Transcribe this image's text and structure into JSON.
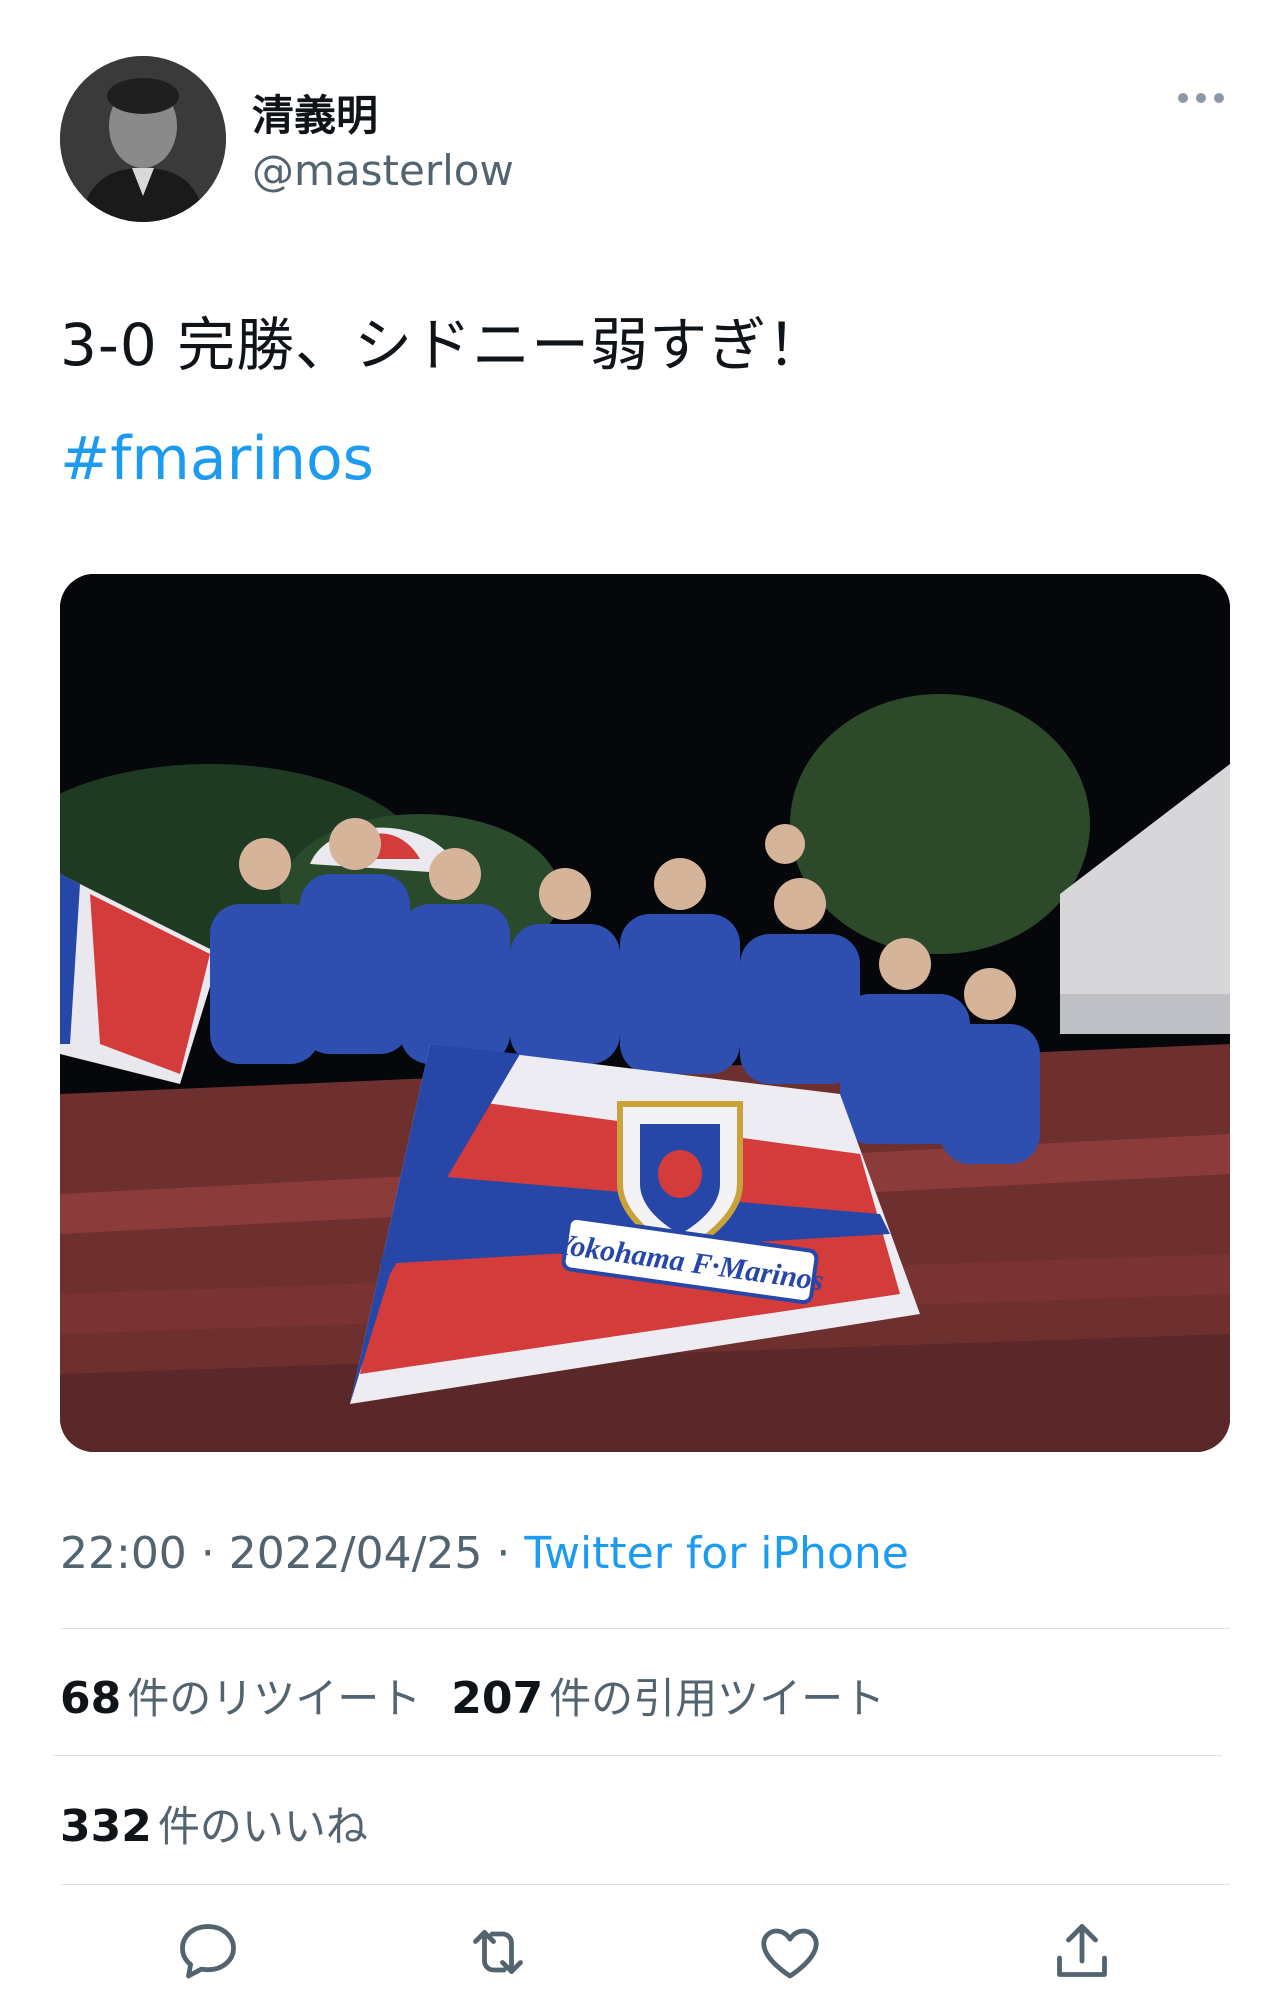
{
  "user": {
    "display_name": "清義明",
    "handle": "@masterlow"
  },
  "tweet": {
    "text": "3-0 完勝、シドニー弱すぎ！",
    "hashtag": "#fmarinos",
    "image_flag_text": "Yokohama F·Marinos"
  },
  "meta": {
    "time": "22:00",
    "sep1": " · ",
    "date": "2022/04/25",
    "sep2": " · ",
    "source": "Twitter for iPhone"
  },
  "stats": {
    "retweets_count": "68",
    "retweets_label": "件のリツイート",
    "quotes_count": "207",
    "quotes_label": "件の引用ツイート",
    "likes_count": "332",
    "likes_label": "件のいいね"
  },
  "icons": {
    "more": "more-dots-icon",
    "reply": "reply-icon",
    "retweet": "retweet-icon",
    "like": "heart-icon",
    "share": "share-icon"
  },
  "colors": {
    "link": "#1d9bf0",
    "secondary": "#536471",
    "icon": "#536471"
  }
}
